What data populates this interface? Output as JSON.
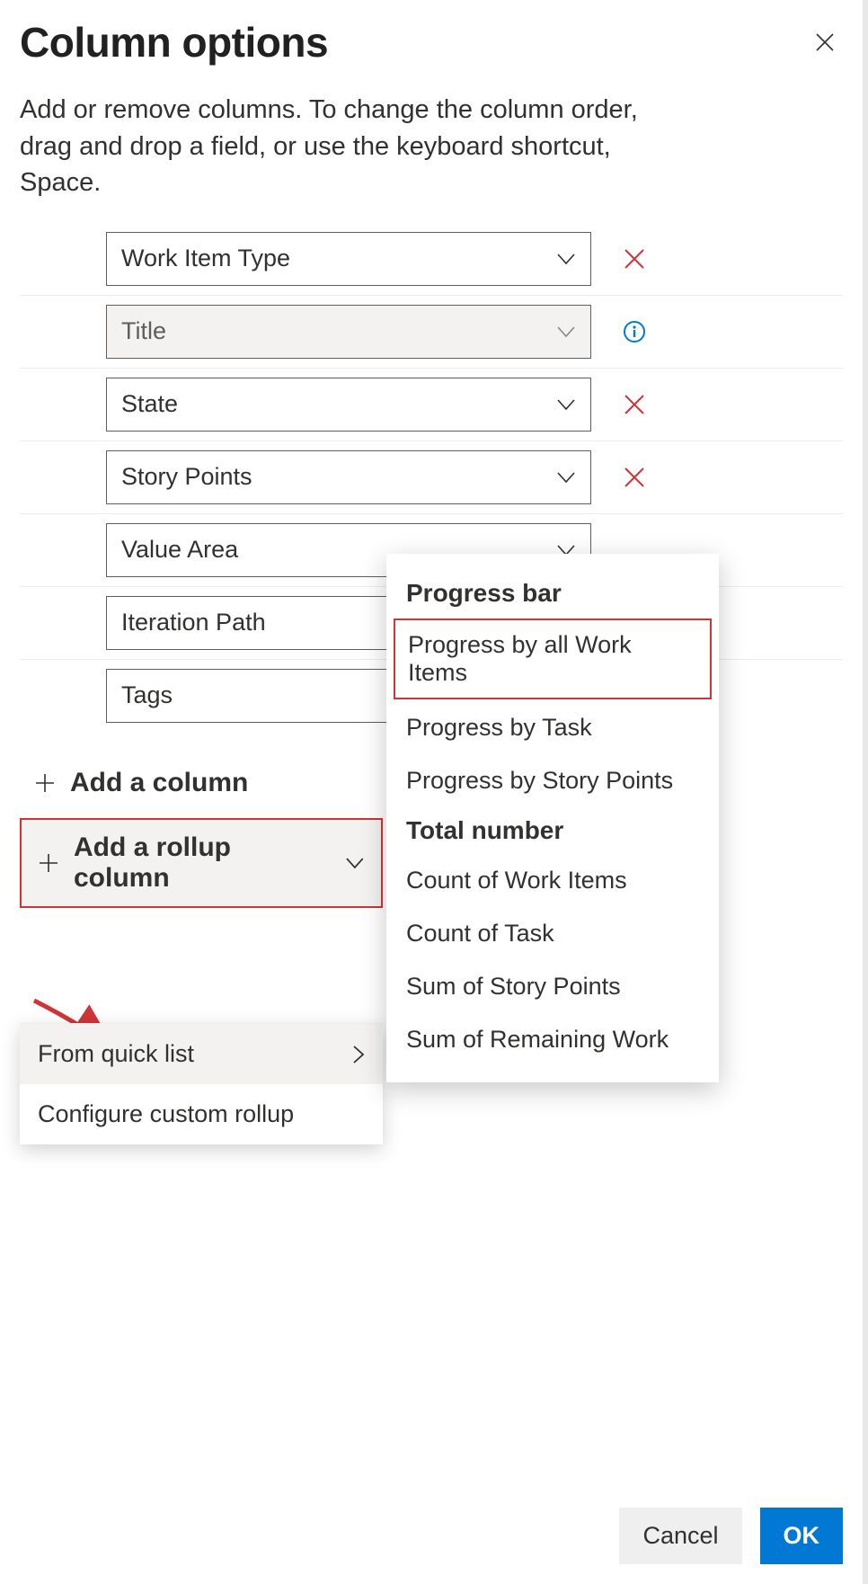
{
  "header": {
    "title": "Column options"
  },
  "description": "Add or remove columns. To change the column order, drag and drop a field, or use the keyboard shortcut, Space.",
  "columns": [
    {
      "label": "Work Item Type",
      "action": "remove",
      "disabled": false
    },
    {
      "label": "Title",
      "action": "info",
      "disabled": true
    },
    {
      "label": "State",
      "action": "remove",
      "disabled": false
    },
    {
      "label": "Story Points",
      "action": "remove",
      "disabled": false
    },
    {
      "label": "Value Area",
      "action": "none",
      "disabled": false
    },
    {
      "label": "Iteration Path",
      "action": "none",
      "disabled": false
    },
    {
      "label": "Tags",
      "action": "none",
      "disabled": false
    }
  ],
  "addColumnLabel": "Add a column",
  "rollupButtonLabel": "Add a rollup column",
  "rollupMenu": {
    "item1": "From quick list",
    "item2": "Configure custom rollup"
  },
  "flyout": {
    "section1": "Progress bar",
    "items1": [
      "Progress by all Work Items",
      "Progress by Task",
      "Progress by Story Points"
    ],
    "section2": "Total number",
    "items2": [
      "Count of Work Items",
      "Count of Task",
      "Sum of Story Points",
      "Sum of Remaining Work"
    ]
  },
  "footer": {
    "cancel": "Cancel",
    "ok": "OK"
  }
}
